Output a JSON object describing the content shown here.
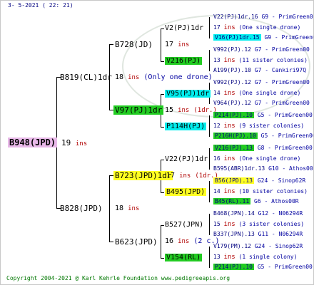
{
  "header": {
    "date": "3-  5-2021 ( 22: 21)"
  },
  "footer": {
    "copyright": "Copyright 2004-2021 @ Karl Kehrle Foundation   www.pedigreeapis.org"
  },
  "root": {
    "name": "B948(JPD)",
    "count": "19",
    "ins": "ins"
  },
  "gen1": [
    {
      "name": "B819(CL)1dr",
      "count": "18",
      "ins": "ins",
      "note": "(Only one drone)"
    },
    {
      "name": "B828(JPD)",
      "count": "18",
      "ins": "ins"
    }
  ],
  "gen2": [
    {
      "name": "B728(JD)",
      "count": "17",
      "ins": "ins"
    },
    {
      "name": "V97(PJ)1dr",
      "count": "15",
      "ins": "ins",
      "note": "(1dr.)"
    },
    {
      "name": "B723(JPD)1dr",
      "count": "17",
      "ins": "ins",
      "note": "(1dr.)"
    },
    {
      "name": "B623(JPD)",
      "count": "16",
      "ins": "ins",
      "note": "(2 c.)"
    }
  ],
  "gen3": [
    {
      "name": "V2(PJ)1dr",
      "count": "17",
      "ins": "ins"
    },
    {
      "name": "V216(PJ)"
    },
    {
      "name": "V95(PJ)1dr",
      "count": "14",
      "ins": "ins"
    },
    {
      "name": "P114H(PJ)",
      "count": "12",
      "ins": "ins"
    },
    {
      "name": "V22(PJ)1dr",
      "count": "16",
      "ins": "ins"
    },
    {
      "name": "B495(JPD)"
    },
    {
      "name": "B527(JPN)"
    },
    {
      "name": "V154(RL)"
    }
  ],
  "gen4": [
    {
      "name": "V22(PJ)1dr.16",
      "breeder": "G9 - PrimGreen00"
    },
    {
      "name": "17",
      "ins": "ins",
      "note": "(One single drone)"
    },
    {
      "name": "V16(PJ)1dr.15",
      "breeder": "G9 - PrimGreen00"
    },
    {
      "name": "V992(PJ).12",
      "breeder": "G7 - PrimGreen00"
    },
    {
      "name": "13",
      "ins": "ins",
      "note": "(11 sister colonies)"
    },
    {
      "name": "A199(PJ).10",
      "breeder": "G7 - Cankiri97Q"
    },
    {
      "name": "V992(PJ).12",
      "breeder": "G7 - PrimGreen00"
    },
    {
      "name": "14",
      "ins": "ins",
      "note": "(One single drone)"
    },
    {
      "name": "V964(PJ).12",
      "breeder": "G7 - PrimGreen00"
    },
    {
      "name": "P214(PJ).10",
      "breeder": "G5 - PrimGreen00"
    },
    {
      "name": "12",
      "ins": "ins",
      "note": "(9 sister colonies)"
    },
    {
      "name": "P216H(PJ).10",
      "breeder": "G5 - PrimGreen00"
    },
    {
      "name": "V216(PJ).13",
      "breeder": "G8 - PrimGreen00"
    },
    {
      "name": "16",
      "ins": "ins",
      "note": "(One single drone)"
    },
    {
      "name": "B595(ABR)1dr.13",
      "breeder": "G10 - Athos00R"
    },
    {
      "name": "B56(JPD).13",
      "breeder": "G24 - Sinop62R"
    },
    {
      "name": "14",
      "ins": "ins",
      "note": "(10 sister colonies)"
    },
    {
      "name": "B45(RL).11",
      "breeder": "G6 - Athos00R"
    },
    {
      "name": "B468(JPN).14",
      "breeder": "G12 - N06294R"
    },
    {
      "name": "15",
      "ins": "ins",
      "note": "(3 sister colonies)"
    },
    {
      "name": "B337(JPN).13",
      "breeder": "G11 - N06294R"
    },
    {
      "name": "V179(PM).12",
      "breeder": "G24 - Sinop62R"
    },
    {
      "name": "13",
      "ins": "ins",
      "note": "(1 single colony)"
    },
    {
      "name": "P214(PJ).10",
      "breeder": "G5 - PrimGreen00"
    }
  ]
}
